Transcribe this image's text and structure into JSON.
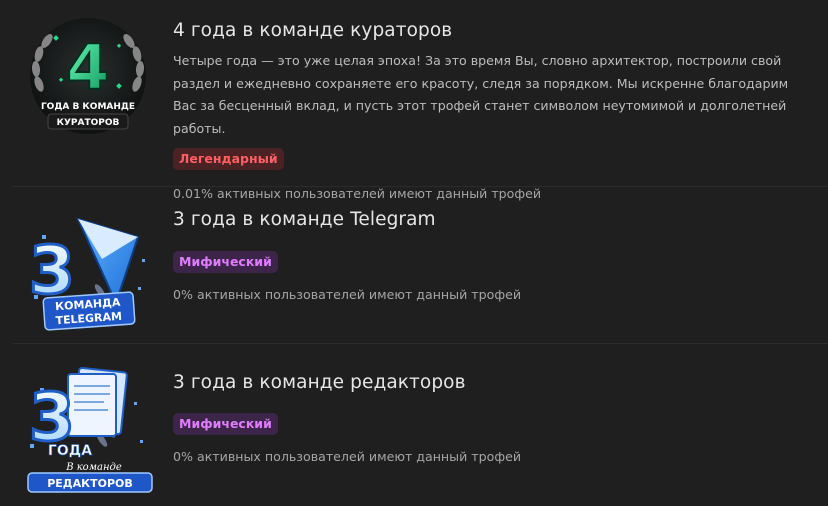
{
  "trophies": [
    {
      "badge_icon": "trophy-curators-4-years-icon",
      "badge_text": {
        "number": "4",
        "line1": "ГОДА В КОМАНДЕ",
        "line2": "КУРАТОРОВ"
      },
      "title": "4 года в команде кураторов",
      "description": "Четыре года — это уже целая эпоха! За это время Вы, словно архитектор, построили свой раздел и ежедневно сохраняете его красоту, следя за порядком. Мы искренне благодарим Вас за бесценный вклад, и пусть этот трофей станет символом неутомимой и долголетней работы.",
      "rarity": "Легендарный",
      "rarity_color": "#ff5f63",
      "stat": "0.01% активных пользователей имеют данный трофей"
    },
    {
      "badge_icon": "trophy-telegram-3-years-icon",
      "badge_text": {
        "number": "3",
        "line1": "КОМАНДА",
        "line2": "TELEGRAM"
      },
      "title": "3 года в команде Telegram",
      "rarity": "Мифический",
      "rarity_color": "#e07cff",
      "stat": "0% активных пользователей имеют данный трофей"
    },
    {
      "badge_icon": "trophy-editors-3-years-icon",
      "badge_text": {
        "number": "3",
        "line1": "ГОДА",
        "line2": "В команде",
        "line3": "РЕДАКТОРОВ"
      },
      "title": "3 года в команде редакторов",
      "rarity": "Мифический",
      "rarity_color": "#e07cff",
      "stat": "0% активных пользователей имеют данный трофей"
    }
  ]
}
